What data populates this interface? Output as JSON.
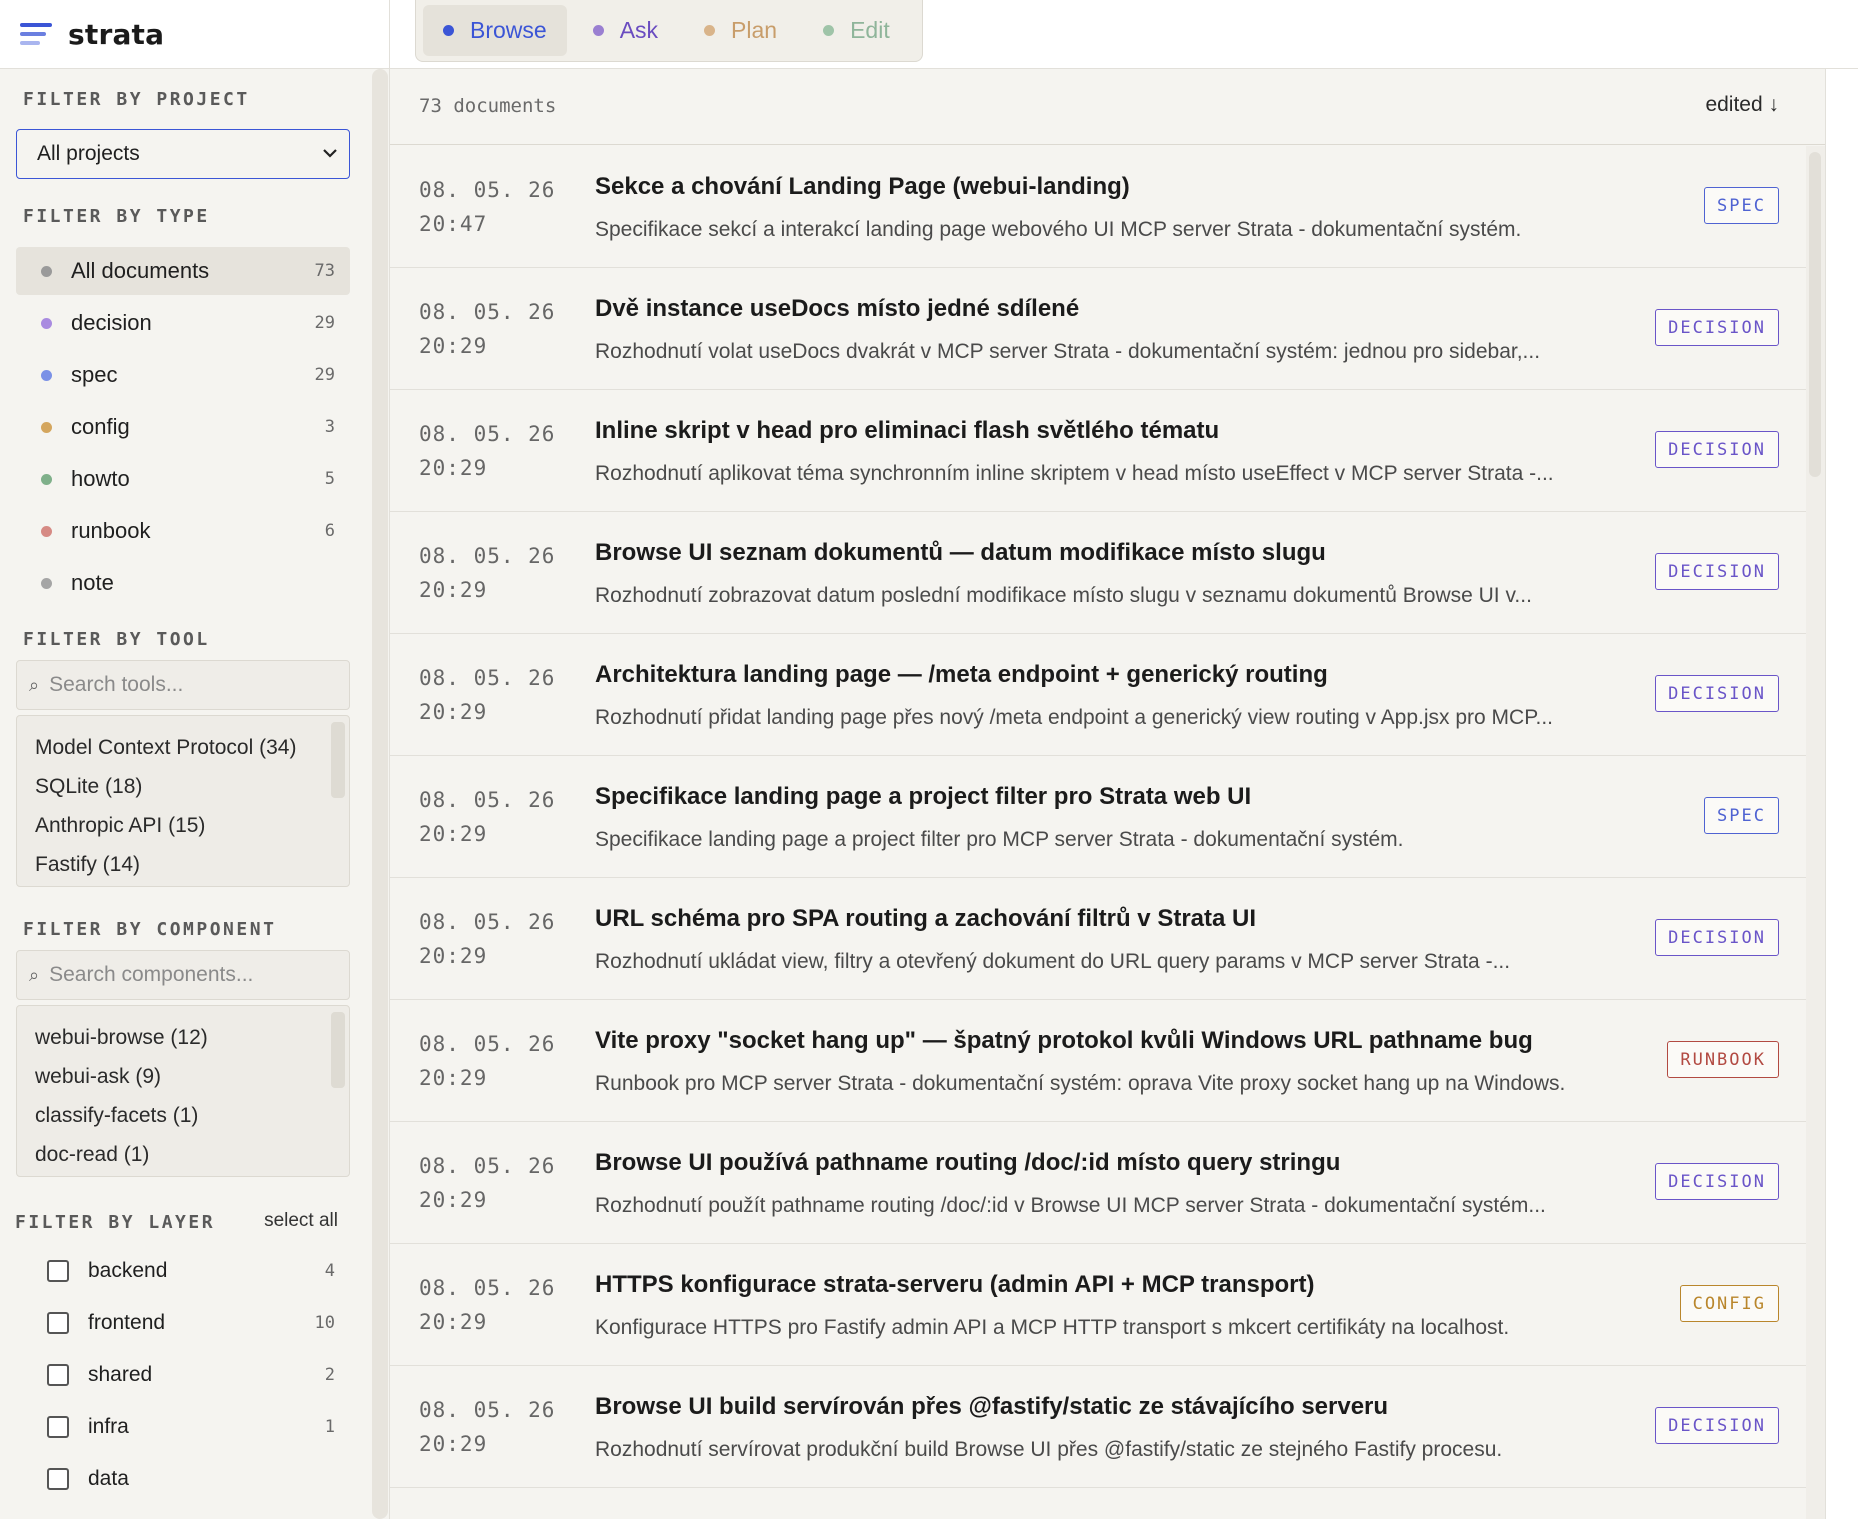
{
  "app": {
    "name": "strata"
  },
  "modes": [
    {
      "label": "Browse",
      "color": "#3b55d6",
      "text_color": "#3b55d6",
      "active": true
    },
    {
      "label": "Ask",
      "color": "#9a7fd1",
      "text_color": "#6a4cc0",
      "active": false
    },
    {
      "label": "Plan",
      "color": "#d9b48a",
      "text_color": "#c89d6a",
      "active": false
    },
    {
      "label": "Edit",
      "color": "#9fc4a8",
      "text_color": "#8fb59a",
      "active": false
    }
  ],
  "sidebar": {
    "project": {
      "title": "FILTER BY PROJECT",
      "selected": "All projects"
    },
    "type": {
      "title": "FILTER BY TYPE",
      "items": [
        {
          "label": "All documents",
          "count": "73",
          "color": "#9a9a9a",
          "active": true
        },
        {
          "label": "decision",
          "count": "29",
          "color": "#a98be0",
          "active": false
        },
        {
          "label": "spec",
          "count": "29",
          "color": "#7b91e6",
          "active": false
        },
        {
          "label": "config",
          "count": "3",
          "color": "#d4a65e",
          "active": false
        },
        {
          "label": "howto",
          "count": "5",
          "color": "#7fb08a",
          "active": false
        },
        {
          "label": "runbook",
          "count": "6",
          "color": "#d68a84",
          "active": false
        },
        {
          "label": "note",
          "count": "",
          "color": "#a5a5a5",
          "active": false
        }
      ]
    },
    "tool": {
      "title": "FILTER BY TOOL",
      "placeholder": "Search tools...",
      "items": [
        "Model Context Protocol (34)",
        "SQLite (18)",
        "Anthropic API (15)",
        "Fastify (14)"
      ]
    },
    "component": {
      "title": "FILTER BY COMPONENT",
      "placeholder": "Search components...",
      "items": [
        "webui-browse (12)",
        "webui-ask (9)",
        "classify-facets (1)",
        "doc-read (1)"
      ]
    },
    "layer": {
      "title": "FILTER BY LAYER",
      "select_all": "select all",
      "items": [
        {
          "label": "backend",
          "count": "4"
        },
        {
          "label": "frontend",
          "count": "10"
        },
        {
          "label": "shared",
          "count": "2"
        },
        {
          "label": "infra",
          "count": "1"
        },
        {
          "label": "data",
          "count": ""
        }
      ]
    }
  },
  "main": {
    "count_label": "73 documents",
    "sort_label": "edited ↓",
    "rows": [
      {
        "date": "08. 05. 26",
        "time": "20:47",
        "title": "Sekce a chování Landing Page (webui-landing)",
        "desc": "Specifikace sekcí a interakcí landing page webového UI MCP server Strata - dokumentační systém.",
        "badge": "SPEC",
        "badge_color": "#4f63d2"
      },
      {
        "date": "08. 05. 26",
        "time": "20:29",
        "title": "Dvě instance useDocs místo jedné sdílené",
        "desc": "Rozhodnutí volat useDocs dvakrát v MCP server Strata - dokumentační systém: jednou pro sidebar,...",
        "badge": "DECISION",
        "badge_color": "#6a55c8"
      },
      {
        "date": "08. 05. 26",
        "time": "20:29",
        "title": "Inline skript v head pro eliminaci flash světlého tématu",
        "desc": "Rozhodnutí aplikovat téma synchronním inline skriptem v head místo useEffect v MCP server Strata -...",
        "badge": "DECISION",
        "badge_color": "#6a55c8"
      },
      {
        "date": "08. 05. 26",
        "time": "20:29",
        "title": "Browse UI seznam dokumentů — datum modifikace místo slugu",
        "desc": "Rozhodnutí zobrazovat datum poslední modifikace místo slugu v seznamu dokumentů Browse UI v...",
        "badge": "DECISION",
        "badge_color": "#6a55c8"
      },
      {
        "date": "08. 05. 26",
        "time": "20:29",
        "title": "Architektura landing page — /meta endpoint + generický routing",
        "desc": "Rozhodnutí přidat landing page přes nový /meta endpoint a generický view routing v App.jsx pro MCP...",
        "badge": "DECISION",
        "badge_color": "#6a55c8"
      },
      {
        "date": "08. 05. 26",
        "time": "20:29",
        "title": "Specifikace landing page a project filter pro Strata web UI",
        "desc": "Specifikace landing page a project filter pro MCP server Strata - dokumentační systém.",
        "badge": "SPEC",
        "badge_color": "#4f63d2"
      },
      {
        "date": "08. 05. 26",
        "time": "20:29",
        "title": "URL schéma pro SPA routing a zachování filtrů v Strata UI",
        "desc": "Rozhodnutí ukládat view, filtry a otevřený dokument do URL query params v MCP server Strata -...",
        "badge": "DECISION",
        "badge_color": "#6a55c8"
      },
      {
        "date": "08. 05. 26",
        "time": "20:29",
        "title": "Vite proxy \"socket hang up\" — špatný protokol kvůli Windows URL pathname bug",
        "desc": "Runbook pro MCP server Strata - dokumentační systém: oprava Vite proxy socket hang up na Windows.",
        "badge": "RUNBOOK",
        "badge_color": "#b24a42"
      },
      {
        "date": "08. 05. 26",
        "time": "20:29",
        "title": "Browse UI používá pathname routing /doc/:id místo query stringu",
        "desc": "Rozhodnutí použít pathname routing /doc/:id v Browse UI MCP server Strata - dokumentační systém...",
        "badge": "DECISION",
        "badge_color": "#6a55c8"
      },
      {
        "date": "08. 05. 26",
        "time": "20:29",
        "title": "HTTPS konfigurace strata-serveru (admin API + MCP transport)",
        "desc": "Konfigurace HTTPS pro Fastify admin API a MCP HTTP transport s mkcert certifikáty na localhost.",
        "badge": "CONFIG",
        "badge_color": "#b9862c"
      },
      {
        "date": "08. 05. 26",
        "time": "20:29",
        "title": "Browse UI build servírován přes @fastify/static ze stávajícího serveru",
        "desc": "Rozhodnutí servírovat produkční build Browse UI přes @fastify/static ze stejného Fastify procesu.",
        "badge": "DECISION",
        "badge_color": "#6a55c8"
      }
    ]
  }
}
